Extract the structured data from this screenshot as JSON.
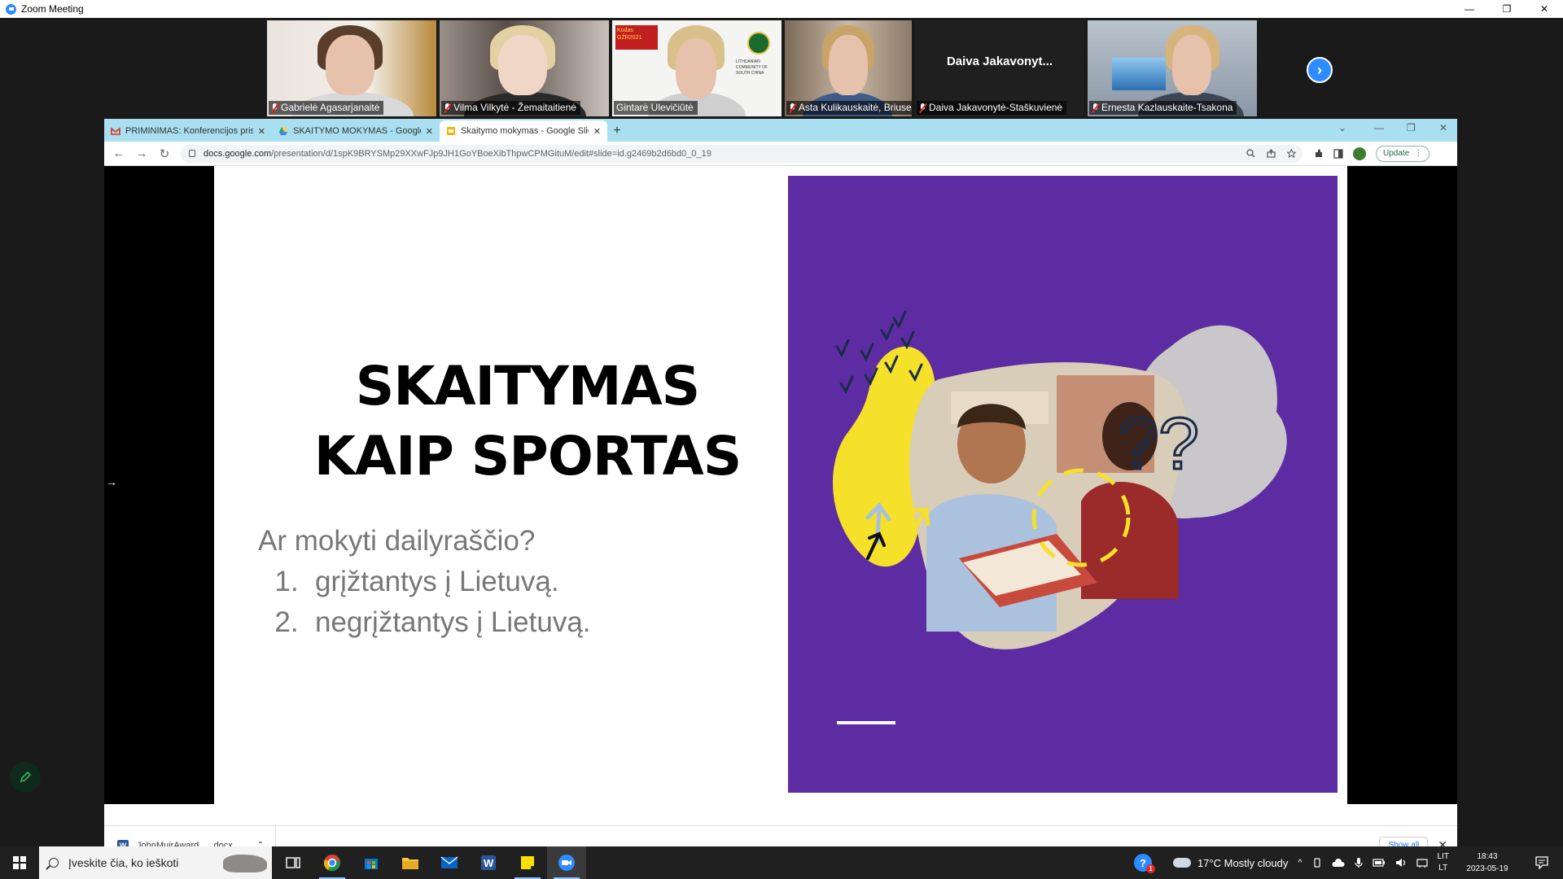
{
  "zoom": {
    "title": "Zoom Meeting",
    "controls": {
      "minimize": "—",
      "restore": "❐",
      "close": "✕"
    },
    "participants": [
      {
        "name": "Gabrielė Agasarjanaitė",
        "muted": true
      },
      {
        "name": "Vilma Vilkytė - Žemaitaitienė",
        "muted": true
      },
      {
        "name": "Gintarė Ulevičiūtė",
        "muted": false,
        "active_speaker": true
      },
      {
        "name": "Asta Kulikauskaitė, Briuselis, B...",
        "muted": true
      },
      {
        "name": "Daiva Jakavonytė-Staškuvienė",
        "muted": true,
        "video_off_label": "Daiva  Jakavonyt..."
      },
      {
        "name": "Ernesta Kazlauskaite-Tsakona",
        "muted": true
      }
    ],
    "next_page_glyph": "›",
    "background_overlay": {
      "line1": "Kodas GŽR2021",
      "line2": "LITHUANIAN COMMUNITY OF SOUTH CHINA"
    }
  },
  "browser": {
    "tabs": [
      {
        "label": "PRIMINIMAS: Konferencijos prisi...",
        "icon": "gmail-icon",
        "close": "✕"
      },
      {
        "label": "SKAITYMO MOKYMAS - Google D...",
        "icon": "drive-icon",
        "close": "✕"
      },
      {
        "label": "Skaitymo mokymas - Google Slid...",
        "icon": "slides-icon",
        "close": "✕",
        "active": true
      }
    ],
    "new_tab": "+",
    "window_controls": {
      "dropdown": "⌄",
      "minimize": "—",
      "restore": "❐",
      "close": "✕"
    },
    "url_host": "docs.google.com",
    "url_path": "/presentation/d/1spK9BRYSMp29XXwFJp9JH1GoYBoeXibThpwCPMGituM/edit#slide=id.g2469b2d6bd0_0_19",
    "update_label": "Update",
    "nav": {
      "back": "←",
      "forward": "→",
      "reload": "↻"
    },
    "download": {
      "filename": "JohnMuirAward_....docx",
      "show_all": "Show all",
      "close": "✕",
      "caret": "⌃"
    }
  },
  "slide": {
    "title_line1": "SKAITYMAS",
    "title_line2": "KAIP SPORTAS",
    "question": "Ar mokyti dailyraščio?",
    "items": [
      {
        "num": "1.",
        "text": "grįžtantys į Lietuvą."
      },
      {
        "num": "2.",
        "text": "negrįžtantys į Lietuvą."
      }
    ],
    "panel_color": "#5e2ca2",
    "accent_yellow": "#f5e02a",
    "edge_arrow": "→"
  },
  "taskbar": {
    "search_placeholder": "Įveskite čia, ko ieškoti",
    "apps": [
      "task-view-icon",
      "chrome-icon",
      "store-icon",
      "file-explorer-icon",
      "mail-icon",
      "word-icon",
      "sticky-notes-icon",
      "zoom-icon"
    ],
    "weather": "17°C  Mostly cloudy",
    "lang_line1": "LIT",
    "lang_line2": "LT",
    "time": "18:43",
    "date": "2023-05-19",
    "help_badge": "1",
    "up_caret": "^"
  }
}
